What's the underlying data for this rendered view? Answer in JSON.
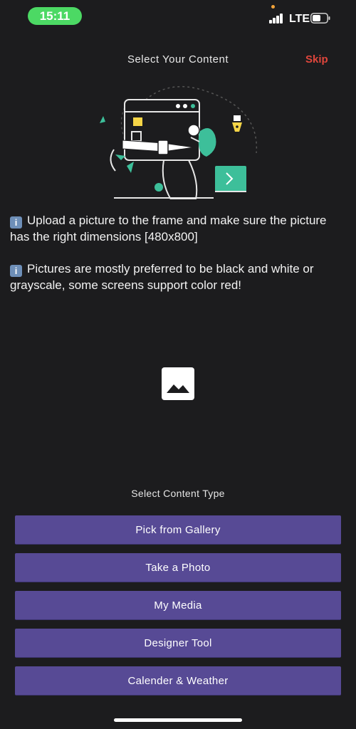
{
  "status_bar": {
    "time": "15:11",
    "network": "LTE"
  },
  "header": {
    "title": "Select Your Content",
    "skip_label": "Skip"
  },
  "info": [
    {
      "icon": "info-icon",
      "badge": "i",
      "text": "Upload a picture to the frame and make sure the picture has the right dimensions [480x800]"
    },
    {
      "icon": "info-icon",
      "badge": "i",
      "text": "Pictures are mostly preferred to be black and white or grayscale, some screens support color red!"
    }
  ],
  "placeholder": {
    "icon": "image-icon"
  },
  "content_type": {
    "label": "Select Content Type",
    "buttons": [
      {
        "label": "Pick from Gallery"
      },
      {
        "label": "Take a Photo"
      },
      {
        "label": "My Media"
      },
      {
        "label": "Designer Tool"
      },
      {
        "label": "Calender & Weather"
      }
    ]
  },
  "colors": {
    "background": "#1c1c1e",
    "button": "#574a95",
    "accent_red": "#e0463c",
    "status_green": "#4cd964",
    "illustration_teal": "#3dbf9a",
    "illustration_yellow": "#f5d547"
  }
}
